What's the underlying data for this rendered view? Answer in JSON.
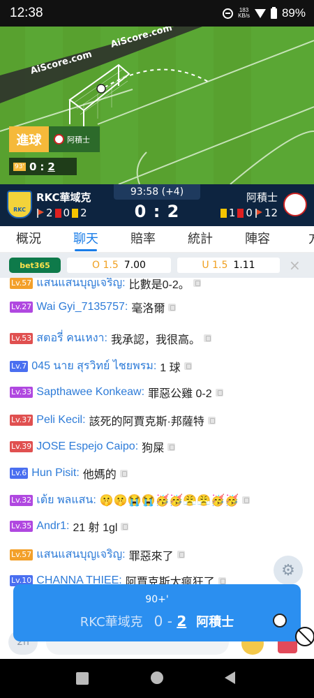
{
  "status_bar": {
    "time": "12:38",
    "speed": "183",
    "speed_unit": "KB/s",
    "battery": "89%"
  },
  "animation": {
    "watermark_1": "AiScore.com",
    "watermark_2": "AiScore.com",
    "event_label": "進球",
    "event_team": "阿積士",
    "minute_badge": "93'",
    "home_goals": "0",
    "score_sep": ":",
    "away_goals": "2"
  },
  "match": {
    "home_team": "RKC華域克",
    "away_team": "阿積士",
    "clock": "93:58 (+4)",
    "score": "0 : 2",
    "home_stats": {
      "corners": "2",
      "red": "0",
      "yellow": "2"
    },
    "away_stats": {
      "yellow": "1",
      "red": "0",
      "corners": "12"
    },
    "home_logo_text": "RKC"
  },
  "tabs": [
    "概況",
    "聊天",
    "賠率",
    "統計",
    "陣容",
    "方"
  ],
  "active_tab": "聊天",
  "odds": {
    "bookmaker": "bet365",
    "over_label": "O 1.5",
    "over_value": "7.00",
    "under_label": "U 1.5",
    "under_value": "1.11",
    "close": "×"
  },
  "chat": [
    {
      "level": "Lv.57",
      "level_color": "orange",
      "user": "แสนแสนบุญเจริญ",
      "text": "比數是0-2。"
    },
    {
      "level": "Lv.27",
      "level_color": "purple",
      "user": "Wai Gyi_7135757",
      "text": "毫洛爾"
    },
    {
      "level": "Lv.53",
      "level_color": "red",
      "user": "สตอรี่ คนเหงา",
      "text": "我承認，我很高。"
    },
    {
      "level": "Lv.7",
      "level_color": "blue",
      "user": "045 นาย สุรวิทย์ ไชยพรม",
      "text": "1 球"
    },
    {
      "level": "Lv.33",
      "level_color": "purple",
      "user": "Sapthawee Konkeaw",
      "text": "罪惡公雞 0-2"
    },
    {
      "level": "Lv.37",
      "level_color": "red",
      "user": "Peli Kecil",
      "text": "該死的阿賈克斯·邦薩特"
    },
    {
      "level": "Lv.39",
      "level_color": "red",
      "user": "JOSE Espejo Caipo",
      "text": "狗屎"
    },
    {
      "level": "Lv.6",
      "level_color": "blue",
      "user": "Hun Pisit",
      "text": "他媽的"
    },
    {
      "level": "Lv.32",
      "level_color": "purple",
      "user": "เต้ย พลแสน",
      "text": "🤫🤫😭😭🥳🥳😤😤🥳🥳"
    },
    {
      "level": "Lv.35",
      "level_color": "purple",
      "user": "Andr1",
      "text": "21 射 1gl"
    },
    {
      "level": "Lv.57",
      "level_color": "orange",
      "user": "แสนแสนบุญเจริญ",
      "text": "罪惡來了"
    },
    {
      "level": "Lv.10",
      "level_color": "blue",
      "user": "CHANNA THIEE",
      "text": "阿賈克斯太瘋狂了"
    }
  ],
  "input_bar": {
    "left_button": "2h"
  },
  "goal_toast": {
    "minute": "90+'",
    "home": "RKC華域克",
    "home_goals": "0",
    "dash": "-",
    "away_goals": "2",
    "away": "阿積士"
  },
  "colors": {
    "accent": "#1a7de8",
    "header_bg": "#0d2440",
    "toast_bg": "#2b8ff0",
    "pitch": "#58a12f"
  }
}
